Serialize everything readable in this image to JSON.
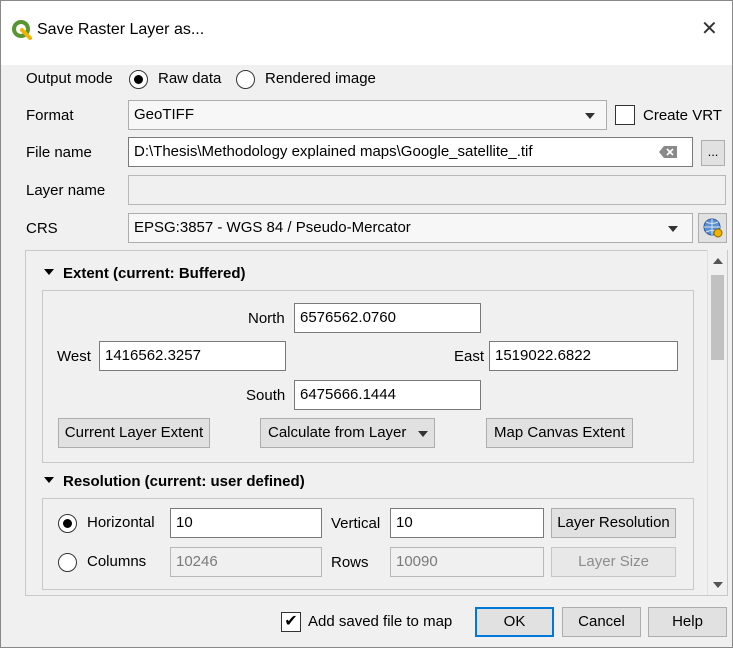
{
  "window": {
    "title": "Save Raster Layer as...",
    "close_label": "✕"
  },
  "output_mode": {
    "label": "Output mode",
    "raw_label": "Raw data",
    "rendered_label": "Rendered image",
    "selected": "Raw data"
  },
  "format": {
    "label": "Format",
    "value": "GeoTIFF",
    "create_vrt_label": "Create VRT",
    "create_vrt_checked": false
  },
  "file_name": {
    "label": "File name",
    "value": "D:\\Thesis\\Methodology explained maps\\Google_satellite_.tif",
    "browse_label": "..."
  },
  "layer_name": {
    "label": "Layer name",
    "value": ""
  },
  "crs": {
    "label": "CRS",
    "value": "EPSG:3857 - WGS 84 / Pseudo-Mercator"
  },
  "extent": {
    "header": "Extent (current: Buffered)",
    "north_label": "North",
    "north": "6576562.0760",
    "west_label": "West",
    "west": "1416562.3257",
    "east_label": "East",
    "east": "1519022.6822",
    "south_label": "South",
    "south": "6475666.1444",
    "current_layer_btn": "Current Layer Extent",
    "calculate_btn": "Calculate from Layer",
    "map_canvas_btn": "Map Canvas Extent"
  },
  "resolution": {
    "header": "Resolution (current: user defined)",
    "horizontal_label": "Horizontal",
    "horizontal": "10",
    "vertical_label": "Vertical",
    "vertical": "10",
    "layer_resolution_btn": "Layer Resolution",
    "columns_label": "Columns",
    "columns": "10246",
    "rows_label": "Rows",
    "rows": "10090",
    "layer_size_btn": "Layer Size",
    "selected": "Horizontal"
  },
  "footer": {
    "add_to_map_label": "Add saved file to map",
    "add_to_map_checked": true,
    "check_mark": "✔",
    "ok_label": "OK",
    "cancel_label": "Cancel",
    "help_label": "Help"
  },
  "colors": {
    "accent": "#0078d7",
    "qgis_green": "#589632",
    "qgis_yellow": "#f0b400"
  }
}
